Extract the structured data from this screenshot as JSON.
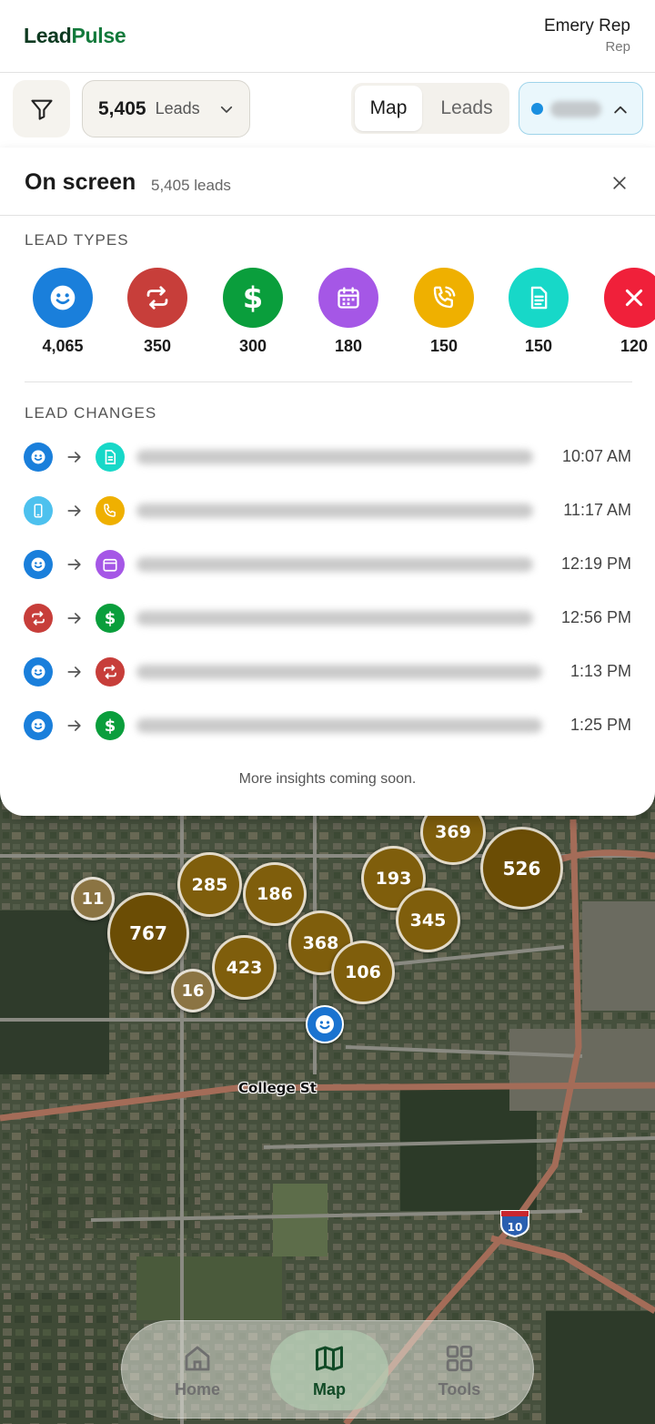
{
  "app": {
    "logo_a": "Lead",
    "logo_b": "Pulse"
  },
  "user": {
    "name": "Emery Rep",
    "role": "Rep"
  },
  "toolbar": {
    "filter_icon": "filter-icon",
    "leads_count": "5,405",
    "leads_label": "Leads",
    "view_tabs": [
      {
        "label": "Map",
        "selected": true
      },
      {
        "label": "Leads",
        "selected": false
      }
    ],
    "team_dot_color": "#1a8fe0"
  },
  "panel": {
    "title": "On screen",
    "count": "5,405 leads",
    "lead_types_label": "LEAD TYPES",
    "lead_types": [
      {
        "icon": "smiley-icon",
        "color": "#1a7fdb",
        "count": "4,065"
      },
      {
        "icon": "repeat-icon",
        "color": "#c73e3a",
        "count": "350"
      },
      {
        "icon": "dollar-icon",
        "color": "#0a9e3c",
        "count": "300"
      },
      {
        "icon": "calendar-icon",
        "color": "#a557e6",
        "count": "180"
      },
      {
        "icon": "phone-icon",
        "color": "#efb000",
        "count": "150"
      },
      {
        "icon": "document-icon",
        "color": "#17d8c8",
        "count": "150"
      },
      {
        "icon": "x-icon",
        "color": "#f0203a",
        "count": "120"
      }
    ],
    "lead_changes_label": "LEAD CHANGES",
    "lead_changes": [
      {
        "from": "smiley-icon",
        "to": "document-icon",
        "time": "10:07 AM"
      },
      {
        "from": "mobile-icon",
        "to": "phone-icon",
        "time": "11:17 AM"
      },
      {
        "from": "smiley-icon",
        "to": "calendar-icon",
        "time": "12:19 PM"
      },
      {
        "from": "repeat-icon",
        "to": "dollar-icon",
        "time": "12:56 PM"
      },
      {
        "from": "smiley-icon",
        "to": "repeat-icon",
        "time": "1:13 PM"
      },
      {
        "from": "smiley-icon",
        "to": "dollar-icon",
        "time": "1:25 PM"
      }
    ],
    "footer": "More insights coming soon."
  },
  "map": {
    "clusters": [
      "11",
      "767",
      "285",
      "186",
      "423",
      "16",
      "368",
      "106",
      "193",
      "369",
      "345",
      "526"
    ],
    "street_label": "College St",
    "highway_label": "10"
  },
  "nav": [
    {
      "label": "Home",
      "icon": "home-icon",
      "active": false
    },
    {
      "label": "Map",
      "icon": "map-icon",
      "active": true
    },
    {
      "label": "Tools",
      "icon": "grid-icon",
      "active": false
    }
  ]
}
